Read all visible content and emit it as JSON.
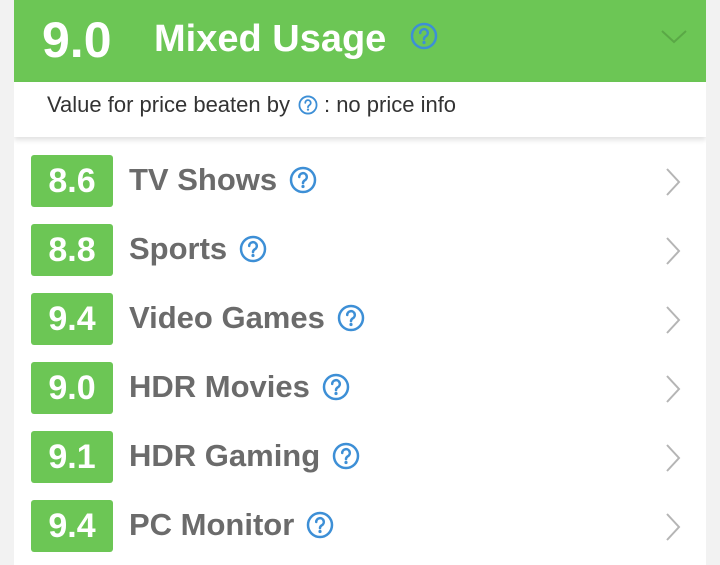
{
  "header": {
    "score": "9.0",
    "title": "Mixed Usage",
    "help_icon": "question-circle-icon",
    "chevron_icon": "chevron-down-icon"
  },
  "subbar": {
    "prefix": "Value for price beaten by",
    "suffix": ": no price info"
  },
  "colors": {
    "accent_green": "#6cc655",
    "help_blue": "#3d8fd6",
    "label_gray": "#6b6b6b"
  },
  "rows": [
    {
      "score": "8.6",
      "label": "TV Shows"
    },
    {
      "score": "8.8",
      "label": "Sports"
    },
    {
      "score": "9.4",
      "label": "Video Games"
    },
    {
      "score": "9.0",
      "label": "HDR Movies"
    },
    {
      "score": "9.1",
      "label": "HDR Gaming"
    },
    {
      "score": "9.4",
      "label": "PC Monitor"
    }
  ]
}
